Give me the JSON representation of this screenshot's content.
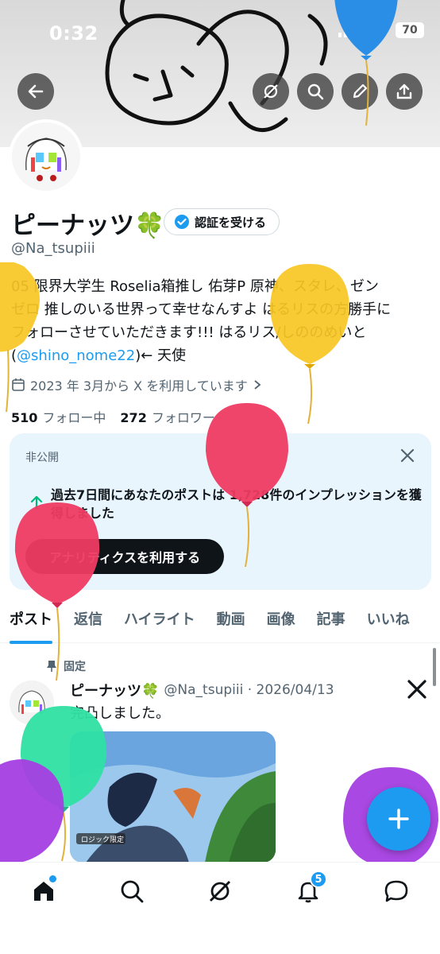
{
  "status_bar": {
    "time": "0:32",
    "battery": "70"
  },
  "profile": {
    "name": "ピーナッツ🍀",
    "verify_button": "認証を受ける",
    "handle": "@Na_tsupiii",
    "bio_line1": "05 限界大学生 Roselia箱推し 佑芽P 原神、スタレ、ゼン",
    "bio_line2": "ゼロ 推しのいる世界って幸せなんすよ はるリスの方勝手に",
    "bio_line3": "フォローさせていただきます!!! はるリス/しののめいと",
    "bio_line4_prefix": "(",
    "bio_mention": "@shino_nome22",
    "bio_line4_suffix": ")← 天使",
    "joined": "2023 年 3月から X を利用しています",
    "following_count": "510",
    "following_label": "フォロー中",
    "followers_count": "272",
    "followers_label": "フォロワー"
  },
  "private_card": {
    "label": "非公開",
    "text": "過去7日間にあなたのポストは 1,728件のインプレッションを獲得しました",
    "button": "アナリティクスを利用する"
  },
  "tabs": [
    "ポスト",
    "返信",
    "ハイライト",
    "動画",
    "画像",
    "記事",
    "いいね"
  ],
  "pinned_post": {
    "pinned_label": "固定",
    "author": "ピーナッツ🍀",
    "meta": "@Na_tsupiii · 2026/04/13",
    "text": "完凸しました。",
    "image_caption": "ロジック限定"
  },
  "bottom_nav": {
    "notifications_badge": "5"
  },
  "colors": {
    "accent": "#1d9bf0",
    "text": "#0f1419",
    "secondary": "#536471",
    "card_bg": "#e8f5fd"
  },
  "icons": [
    "back-arrow-icon",
    "grok-icon",
    "search-icon",
    "edit-icon",
    "share-icon",
    "verified-badge-icon",
    "calendar-icon",
    "chevron-right-icon",
    "close-icon",
    "trend-up-icon",
    "pin-icon",
    "x-logo-icon",
    "plus-icon",
    "home-icon",
    "notifications-icon",
    "messages-icon"
  ]
}
